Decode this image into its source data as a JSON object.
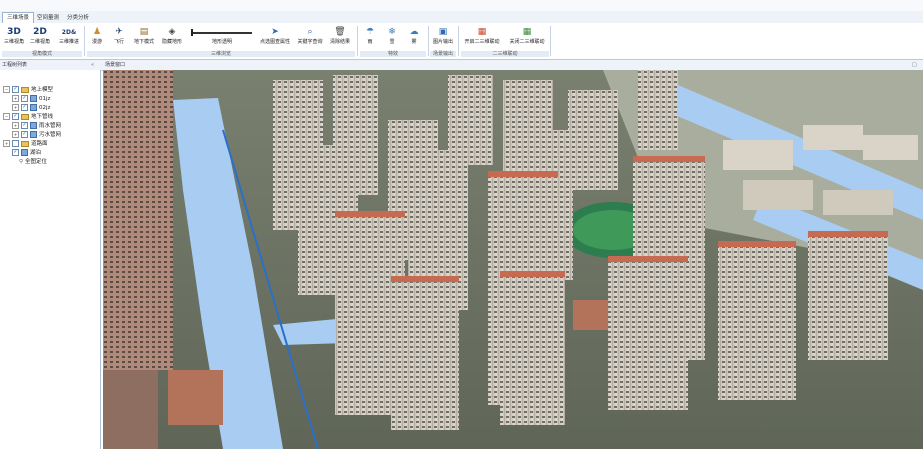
{
  "tabs": [
    {
      "label": "三维场景",
      "active": true
    },
    {
      "label": "空间量测",
      "active": false
    },
    {
      "label": "分类分析",
      "active": false
    }
  ],
  "ribbon": {
    "view_mode": {
      "title": "视角模式",
      "buttons": [
        {
          "icon": "3D",
          "label": "三维视角"
        },
        {
          "icon": "2D",
          "label": "二维视角"
        },
        {
          "icon": "2D&",
          "label": "三维推进"
        }
      ]
    },
    "roaming": {
      "title": "三维浏览",
      "buttons": [
        {
          "label": "漫游"
        },
        {
          "label": "飞行"
        },
        {
          "label": "地下模式"
        },
        {
          "label": "隐藏地形"
        },
        {
          "label": "地形透明"
        },
        {
          "label": "点选图查属性"
        },
        {
          "label": "关键字查询"
        },
        {
          "label": "清除结果"
        }
      ]
    },
    "weather": {
      "title": "特效",
      "buttons": [
        {
          "label": "雨"
        },
        {
          "label": "雪"
        },
        {
          "label": "雾"
        }
      ]
    },
    "output": {
      "title": "场景输出",
      "buttons": [
        {
          "label": "图片输出"
        }
      ]
    },
    "link": {
      "title": "二三维联动",
      "buttons": [
        {
          "label": "开启二三维联动"
        },
        {
          "label": "关闭二三维联动"
        }
      ]
    }
  },
  "left_panel": {
    "title": "工程树列表",
    "collapse": "«",
    "tree": [
      {
        "label": "地上模型",
        "level": 0,
        "type": "folder",
        "checked": true
      },
      {
        "label": "01jz",
        "level": 1,
        "type": "layer",
        "checked": true
      },
      {
        "label": "02jz",
        "level": 1,
        "type": "layer",
        "checked": true
      },
      {
        "label": "地下管线",
        "level": 0,
        "type": "folder",
        "checked": true
      },
      {
        "label": "雨水管网",
        "level": 1,
        "type": "layer",
        "checked": true
      },
      {
        "label": "污水管网",
        "level": 1,
        "type": "layer",
        "checked": true
      },
      {
        "label": "道路面",
        "level": 0,
        "type": "folder",
        "checked": false
      },
      {
        "label": "湖泊",
        "level": 0,
        "type": "layer",
        "checked": true
      },
      {
        "label": "全图定位",
        "level": 0,
        "type": "locate",
        "checked": false
      }
    ]
  },
  "scene_panel": {
    "title": "场景窗口"
  }
}
